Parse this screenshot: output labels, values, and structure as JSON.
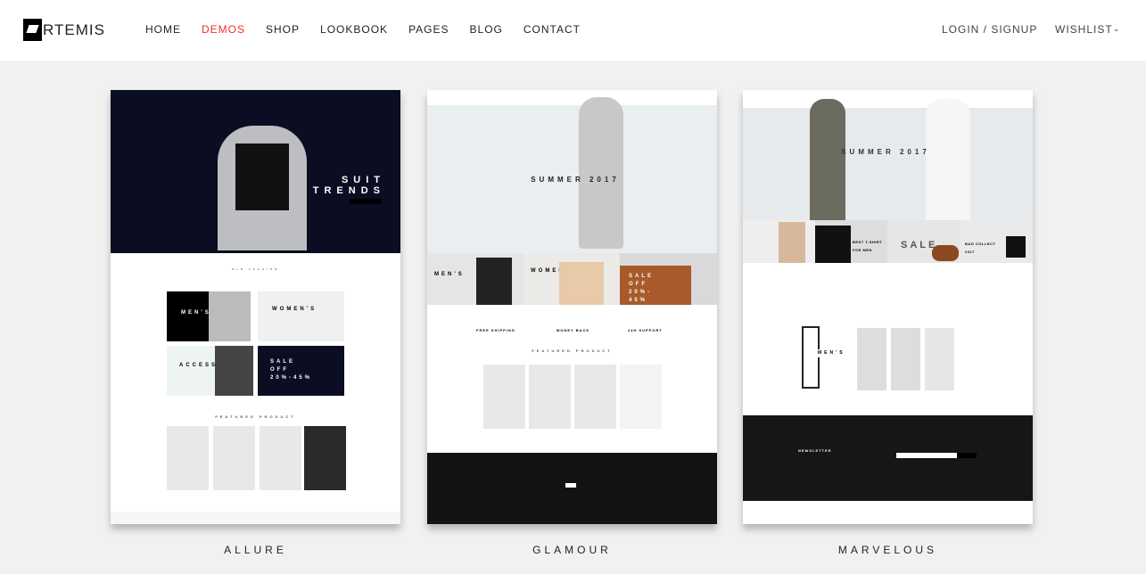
{
  "header": {
    "logo": "RTEMIS",
    "nav": [
      "HOME",
      "DEMOS",
      "SHOP",
      "LOOKBOOK",
      "PAGES",
      "BLOG",
      "CONTACT"
    ],
    "active": "DEMOS",
    "login": "LOGIN / SIGNUP",
    "wishlist": "WISHLIST",
    "chevron": "chevron-down-icon"
  },
  "colors": {
    "accent": "#f0302e",
    "background": "#f1f1f1"
  },
  "demos": [
    {
      "name": "ALLURE",
      "hero_title": "SUIT TRENDS",
      "tiles": [
        "MEN'S",
        "WOMEN'S",
        "ACCESSORIES",
        "SALE OFF 20%-45%"
      ],
      "section": "FEATURED PRODUCT"
    },
    {
      "name": "GLAMOUR",
      "hero_title": "SUMMER 2017",
      "banners": [
        "MEN'S",
        "WOMEN'S",
        "SALE OFF 20%- 45%"
      ],
      "features": [
        "FREE SHIPPING",
        "MONEY BACK",
        "24H SUPPORT"
      ],
      "section": "FEATURED PRODUCT"
    },
    {
      "name": "MARVELOUS",
      "hero_title": "SUMMER 2017",
      "banners": [
        "BEST T-SHIRT FOR MEN",
        "SALE",
        "BAG COLLECT 2017"
      ],
      "featured": "MEN'S",
      "newsletter": "NEWSLETTER"
    }
  ]
}
